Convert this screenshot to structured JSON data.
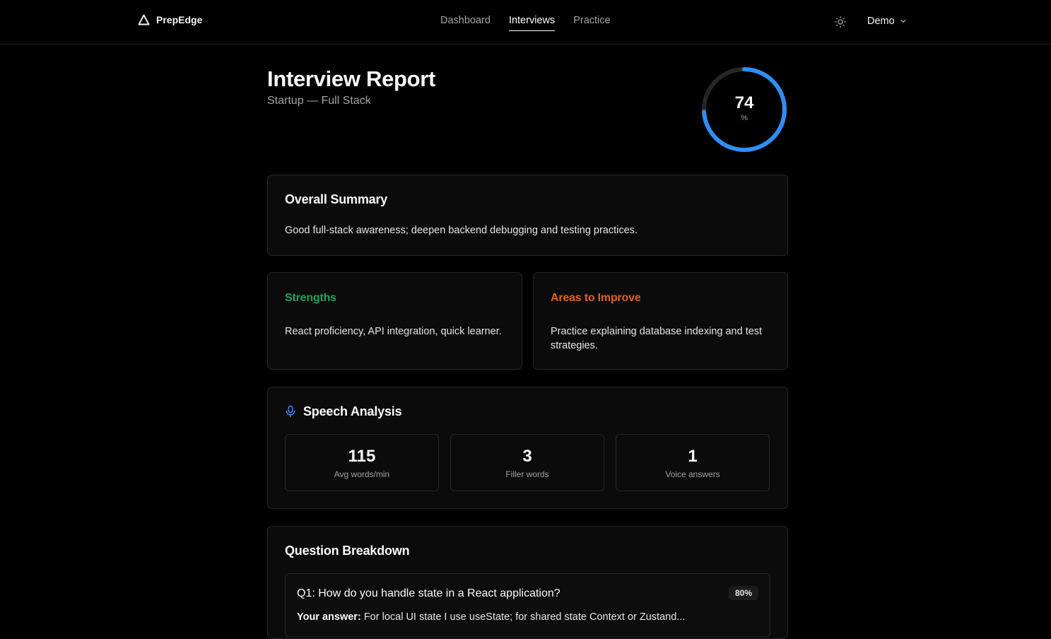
{
  "nav": {
    "brand": "PrepEdge",
    "links": [
      "Dashboard",
      "Interviews",
      "Practice"
    ],
    "user": "Demo"
  },
  "header": {
    "title": "Interview Report",
    "subtitle": "Startup — Full Stack"
  },
  "score": {
    "value": "74",
    "unit": "%",
    "fraction": 0.74,
    "accent": "#2f8ef5"
  },
  "summary": {
    "title": "Overall Summary",
    "text": "Good full-stack awareness; deepen backend debugging and testing practices."
  },
  "strengths": {
    "title": "Strengths",
    "text": "React proficiency, API integration, quick learner.",
    "color": "#22a35a"
  },
  "improve": {
    "title": "Areas to Improve",
    "text": "Practice explaining database indexing and test strategies.",
    "color": "#e0621a"
  },
  "speech": {
    "title": "Speech Analysis",
    "icon": "microphone-icon",
    "stats": [
      {
        "value": "115",
        "label": "Avg words/min"
      },
      {
        "value": "3",
        "label": "Filler words"
      },
      {
        "value": "1",
        "label": "Voice answers"
      }
    ]
  },
  "breakdown": {
    "title": "Question Breakdown",
    "questions": [
      {
        "text": "Q1: How do you handle state in a React application?",
        "score": "80%",
        "answer_label": "Your answer:",
        "answer": "For local UI state I use useState; for shared state Context or Zustand..."
      }
    ]
  }
}
